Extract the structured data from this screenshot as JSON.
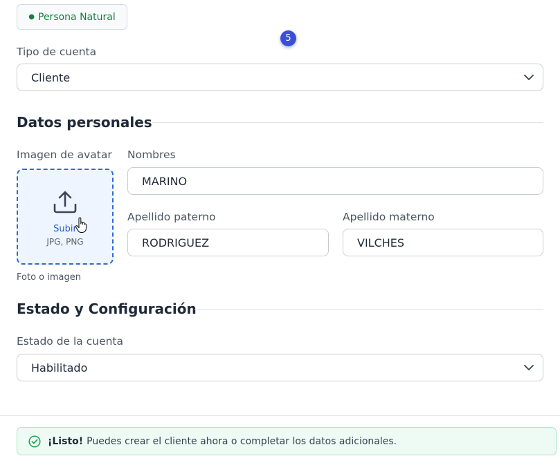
{
  "persona": {
    "dot": "●",
    "label": "Persona Natural"
  },
  "step_badge": "5",
  "account_type": {
    "label": "Tipo de cuenta",
    "value": "Cliente"
  },
  "personal_section": {
    "title": "Datos personales"
  },
  "avatar": {
    "label": "Imagen de avatar",
    "upload_text": "Subir",
    "formats": "JPG, PNG",
    "helper": "Foto o imagen"
  },
  "names": {
    "label": "Nombres",
    "value": "MARINO"
  },
  "paternal": {
    "label": "Apellido paterno",
    "value": "RODRIGUEZ"
  },
  "maternal": {
    "label": "Apellido materno",
    "value": "VILCHES"
  },
  "status_section": {
    "title": "Estado y Configuración"
  },
  "account_status": {
    "label": "Estado de la cuenta",
    "value": "Habilitado"
  },
  "alert": {
    "strong": "¡Listo!",
    "text": "Puedes crear el cliente ahora o completar los datos adicionales."
  },
  "colors": {
    "accent": "#2d6ad3",
    "success": "#15803d",
    "badge": "#3b4fd6"
  },
  "icons": {
    "persona": "status-dot",
    "select": "chevron-down-icon",
    "upload": "upload-icon",
    "cursor": "hand-pointer-icon",
    "alert": "check-circle-icon"
  }
}
